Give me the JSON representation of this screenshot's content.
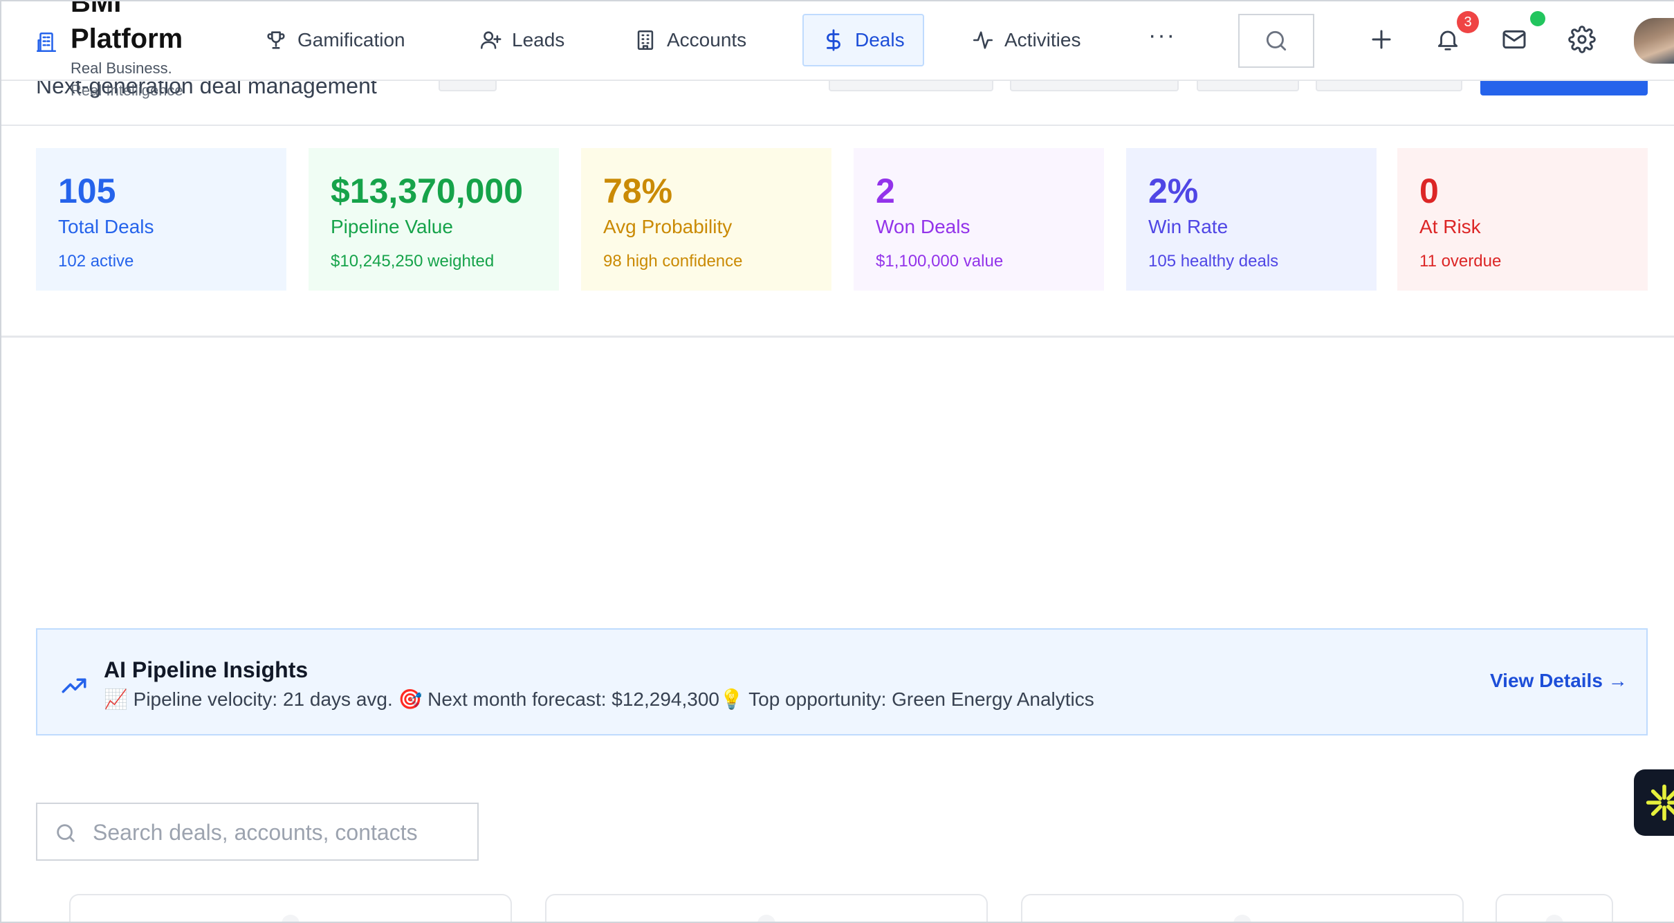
{
  "brand": {
    "title": "BMI",
    "title_line2": "Platform",
    "tagline": "Real Business.",
    "tagline2": "Real Intelligence"
  },
  "nav": {
    "items": [
      {
        "label": "Gamification",
        "icon": "trophy-icon"
      },
      {
        "label": "Leads",
        "icon": "user-plus-icon"
      },
      {
        "label": "Accounts",
        "icon": "building-icon"
      },
      {
        "label": "Deals",
        "icon": "dollar-icon",
        "active": true
      },
      {
        "label": "Activities",
        "icon": "activity-icon"
      }
    ],
    "more": "···",
    "notification_count": "3"
  },
  "page": {
    "subtitle": "Next-generation deal management"
  },
  "stats": [
    {
      "value": "105",
      "label": "Total Deals",
      "sub": "102 active",
      "bg": "#eff6ff",
      "color": "#2563eb"
    },
    {
      "value": "$13,370,000",
      "label": "Pipeline Value",
      "sub": "$10,245,250 weighted",
      "bg": "#f0fdf4",
      "color": "#16a34a"
    },
    {
      "value": "78%",
      "label": "Avg Probability",
      "sub": "98 high confidence",
      "bg": "#fefce8",
      "color": "#ca8a04"
    },
    {
      "value": "2",
      "label": "Won Deals",
      "sub": "$1,100,000 value",
      "bg": "#faf5ff",
      "color": "#9333ea"
    },
    {
      "value": "2%",
      "label": "Win Rate",
      "sub": "105 healthy deals",
      "bg": "#eef2ff",
      "color": "#4f46e5"
    },
    {
      "value": "0",
      "label": "At Risk",
      "sub": "11 overdue",
      "bg": "#fef2f2",
      "color": "#dc2626"
    }
  ],
  "insights": {
    "title": "AI Pipeline Insights",
    "text": "📈 Pipeline velocity: 21 days avg. 🎯 Next month forecast: $12,294,300💡 Top opportunity: Green Energy Analytics",
    "link": "View Details →"
  },
  "search": {
    "placeholder": "Search deals, accounts, contacts"
  },
  "colors": {
    "accent": "#2563eb",
    "badge": "#ef4444",
    "online": "#22c55e"
  }
}
